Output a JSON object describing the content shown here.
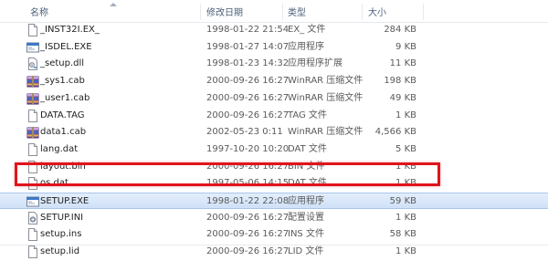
{
  "columns": {
    "name": "名称",
    "date": "修改日期",
    "type": "类型",
    "size": "大小"
  },
  "files": [
    {
      "name": "_INST32I.EX_",
      "date": "1998-01-22 21:54",
      "type": "EX_ 文件",
      "size": "284 KB",
      "icon": "generic-file-icon"
    },
    {
      "name": "_ISDEL.EXE",
      "date": "1998-01-27 14:07",
      "type": "应用程序",
      "size": "9 KB",
      "icon": "application-icon"
    },
    {
      "name": "_setup.dll",
      "date": "1998-01-23 14:32",
      "type": "应用程序扩展",
      "size": "11 KB",
      "icon": "dll-icon"
    },
    {
      "name": "_sys1.cab",
      "date": "2000-09-26 16:27",
      "type": "WinRAR 压缩文件",
      "size": "198 KB",
      "icon": "archive-icon"
    },
    {
      "name": "_user1.cab",
      "date": "2000-09-26 16:27",
      "type": "WinRAR 压缩文件",
      "size": "49 KB",
      "icon": "archive-icon"
    },
    {
      "name": "DATA.TAG",
      "date": "2000-09-26 16:27",
      "type": "TAG 文件",
      "size": "1 KB",
      "icon": "generic-file-icon"
    },
    {
      "name": "data1.cab",
      "date": "2002-05-23 0:11",
      "type": "WinRAR 压缩文件",
      "size": "4,566 KB",
      "icon": "archive-icon"
    },
    {
      "name": "lang.dat",
      "date": "1997-10-20 10:20",
      "type": "DAT 文件",
      "size": "5 KB",
      "icon": "generic-file-icon"
    },
    {
      "name": "layout.bin",
      "date": "2000-09-26 16:27",
      "type": "BIN 文件",
      "size": "1 KB",
      "icon": "generic-file-icon"
    },
    {
      "name": "os.dat",
      "date": "1997-05-06 14:15",
      "type": "DAT 文件",
      "size": "1 KB",
      "icon": "generic-file-icon"
    },
    {
      "name": "SETUP.EXE",
      "date": "1998-01-22 22:08",
      "type": "应用程序",
      "size": "59 KB",
      "icon": "application-icon",
      "selected": true
    },
    {
      "name": "SETUP.INI",
      "date": "2000-09-26 16:27",
      "type": "配置设置",
      "size": "1 KB",
      "icon": "settings-file-icon"
    },
    {
      "name": "setup.ins",
      "date": "2000-09-26 16:27",
      "type": "INS 文件",
      "size": "58 KB",
      "icon": "generic-file-icon"
    },
    {
      "name": "setup.lid",
      "date": "2000-09-26 16:27",
      "type": "LID 文件",
      "size": "1 KB",
      "icon": "generic-file-icon"
    }
  ],
  "colors": {
    "selection": "#cfe1f8",
    "highlight": "#e0141c",
    "header_text": "#4c607a"
  }
}
